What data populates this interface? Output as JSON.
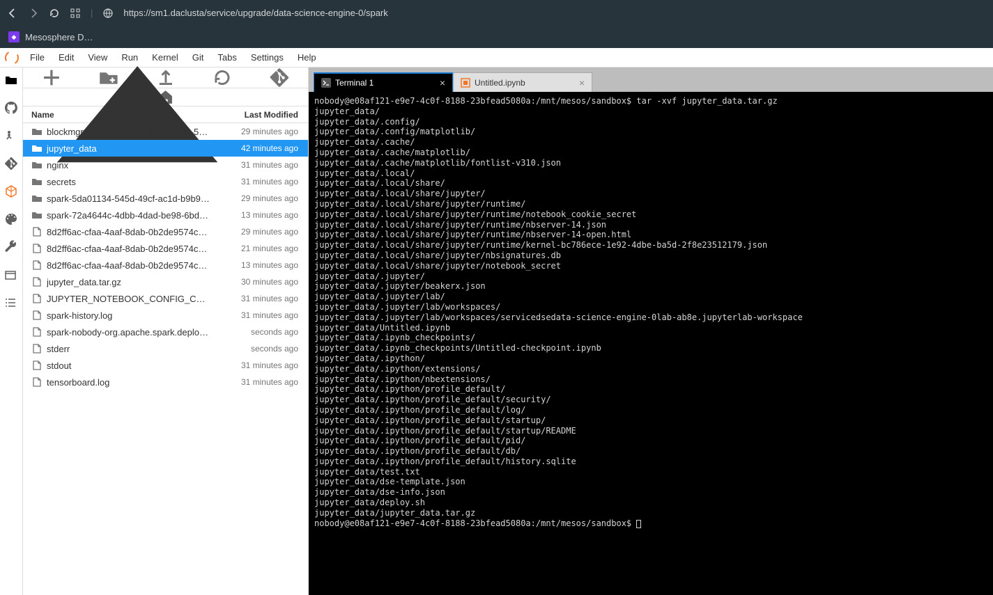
{
  "browser": {
    "url": "https://sm1.daclusta/service/upgrade/data-science-engine-0/spark",
    "tab_title": "Mesosphere D…"
  },
  "menubar": [
    "File",
    "Edit",
    "View",
    "Run",
    "Kernel",
    "Git",
    "Tabs",
    "Settings",
    "Help"
  ],
  "file_panel": {
    "header_name": "Name",
    "header_modified": "Last Modified",
    "items": [
      {
        "type": "folder",
        "name": "blockmgr-617d279e-f4f2-45c7-bb36-5cf…",
        "modified": "29 minutes ago",
        "selected": false
      },
      {
        "type": "folder",
        "name": "jupyter_data",
        "modified": "42 minutes ago",
        "selected": true
      },
      {
        "type": "folder",
        "name": "nginx",
        "modified": "31 minutes ago",
        "selected": false
      },
      {
        "type": "folder",
        "name": "secrets",
        "modified": "31 minutes ago",
        "selected": false
      },
      {
        "type": "folder",
        "name": "spark-5da01134-545d-49cf-ac1d-b9b98…",
        "modified": "29 minutes ago",
        "selected": false
      },
      {
        "type": "folder",
        "name": "spark-72a4644c-4dbb-4dad-be98-6bd5…",
        "modified": "13 minutes ago",
        "selected": false
      },
      {
        "type": "file",
        "name": "8d2ff6ac-cfaa-4aaf-8dab-0b2de9574c0a…",
        "modified": "29 minutes ago",
        "selected": false
      },
      {
        "type": "file",
        "name": "8d2ff6ac-cfaa-4aaf-8dab-0b2de9574c0a…",
        "modified": "21 minutes ago",
        "selected": false
      },
      {
        "type": "file",
        "name": "8d2ff6ac-cfaa-4aaf-8dab-0b2de9574c0a…",
        "modified": "13 minutes ago",
        "selected": false
      },
      {
        "type": "file",
        "name": "jupyter_data.tar.gz",
        "modified": "30 minutes ago",
        "selected": false
      },
      {
        "type": "file",
        "name": "JUPYTER_NOTEBOOK_CONFIG_CO…",
        "modified": "31 minutes ago",
        "selected": false
      },
      {
        "type": "file",
        "name": "spark-history.log",
        "modified": "31 minutes ago",
        "selected": false
      },
      {
        "type": "file",
        "name": "spark-nobody-org.apache.spark.deploy.…",
        "modified": "seconds ago",
        "selected": false
      },
      {
        "type": "file",
        "name": "stderr",
        "modified": "seconds ago",
        "selected": false
      },
      {
        "type": "file",
        "name": "stdout",
        "modified": "31 minutes ago",
        "selected": false
      },
      {
        "type": "file",
        "name": "tensorboard.log",
        "modified": "31 minutes ago",
        "selected": false
      }
    ]
  },
  "work_tabs": [
    {
      "label": "Terminal 1",
      "icon": "terminal",
      "active": true
    },
    {
      "label": "Untitled.ipynb",
      "icon": "notebook",
      "active": false
    }
  ],
  "terminal": {
    "prompt": "nobody@e08af121-e9e7-4c0f-8188-23bfead5080a:/mnt/mesos/sandbox$",
    "command": "tar -xvf jupyter_data.tar.gz",
    "lines": [
      "jupyter_data/",
      "jupyter_data/.config/",
      "jupyter_data/.config/matplotlib/",
      "jupyter_data/.cache/",
      "jupyter_data/.cache/matplotlib/",
      "jupyter_data/.cache/matplotlib/fontlist-v310.json",
      "jupyter_data/.local/",
      "jupyter_data/.local/share/",
      "jupyter_data/.local/share/jupyter/",
      "jupyter_data/.local/share/jupyter/runtime/",
      "jupyter_data/.local/share/jupyter/runtime/notebook_cookie_secret",
      "jupyter_data/.local/share/jupyter/runtime/nbserver-14.json",
      "jupyter_data/.local/share/jupyter/runtime/nbserver-14-open.html",
      "jupyter_data/.local/share/jupyter/runtime/kernel-bc786ece-1e92-4dbe-ba5d-2f8e23512179.json",
      "jupyter_data/.local/share/jupyter/nbsignatures.db",
      "jupyter_data/.local/share/jupyter/notebook_secret",
      "jupyter_data/.jupyter/",
      "jupyter_data/.jupyter/beakerx.json",
      "jupyter_data/.jupyter/lab/",
      "jupyter_data/.jupyter/lab/workspaces/",
      "jupyter_data/.jupyter/lab/workspaces/servicedsedata-science-engine-0lab-ab8e.jupyterlab-workspace",
      "jupyter_data/Untitled.ipynb",
      "jupyter_data/.ipynb_checkpoints/",
      "jupyter_data/.ipynb_checkpoints/Untitled-checkpoint.ipynb",
      "jupyter_data/.ipython/",
      "jupyter_data/.ipython/extensions/",
      "jupyter_data/.ipython/nbextensions/",
      "jupyter_data/.ipython/profile_default/",
      "jupyter_data/.ipython/profile_default/security/",
      "jupyter_data/.ipython/profile_default/log/",
      "jupyter_data/.ipython/profile_default/startup/",
      "jupyter_data/.ipython/profile_default/startup/README",
      "jupyter_data/.ipython/profile_default/pid/",
      "jupyter_data/.ipython/profile_default/db/",
      "jupyter_data/.ipython/profile_default/history.sqlite",
      "jupyter_data/test.txt",
      "jupyter_data/dse-template.json",
      "jupyter_data/dse-info.json",
      "jupyter_data/deploy.sh",
      "jupyter_data/jupyter_data.tar.gz"
    ]
  }
}
